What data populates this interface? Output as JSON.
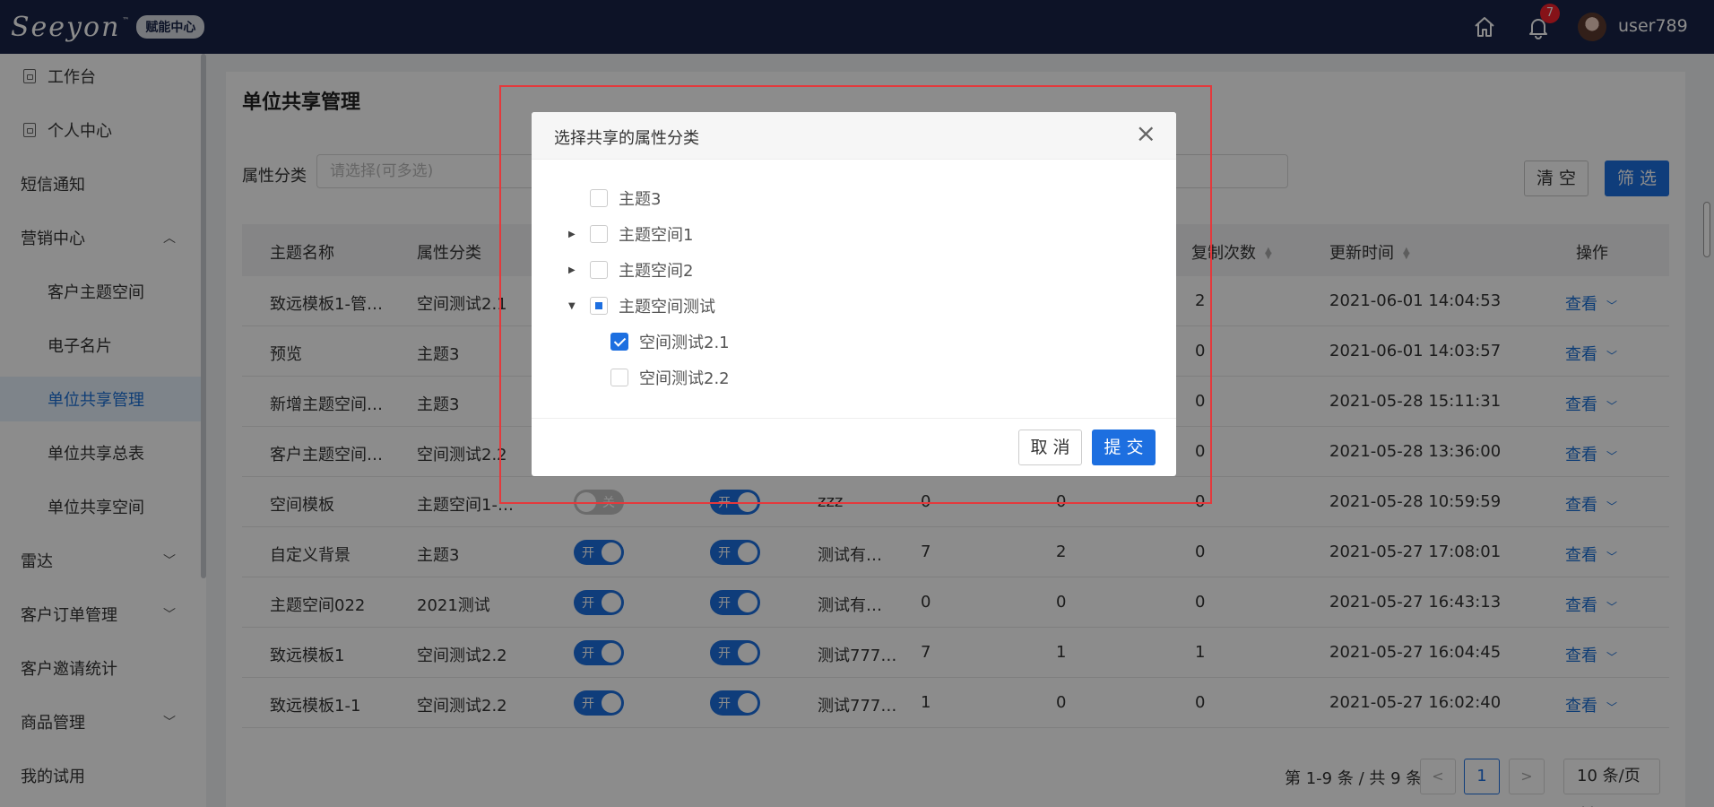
{
  "header": {
    "logo_text": "Seeyon",
    "logo_tm": "™",
    "logo_badge": "赋能中心",
    "notification_count": "7",
    "username": "user789"
  },
  "sidebar": {
    "items": [
      {
        "label": "工作台"
      },
      {
        "label": "个人中心"
      },
      {
        "label": "短信通知"
      },
      {
        "label": "营销中心"
      },
      {
        "label": "客户主题空间"
      },
      {
        "label": "电子名片"
      },
      {
        "label": "单位共享管理"
      },
      {
        "label": "单位共享总表"
      },
      {
        "label": "单位共享空间"
      },
      {
        "label": "雷达"
      },
      {
        "label": "客户订单管理"
      },
      {
        "label": "客户邀请统计"
      },
      {
        "label": "商品管理"
      },
      {
        "label": "我的试用"
      }
    ]
  },
  "page": {
    "title": "单位共享管理",
    "filter_label": "属性分类",
    "filter_placeholder": "请选择(可多选)",
    "clear_label": "清 空",
    "filter_label_btn": "筛 选"
  },
  "table": {
    "headers": [
      "主题名称",
      "属性分类",
      "复制次数",
      "更新时间",
      "操作"
    ],
    "toggle_on": "开",
    "toggle_off": "关",
    "action_label": "查看",
    "rows": [
      {
        "name": "致远模板1-管…",
        "category": "空间测试2.1",
        "copies": "2",
        "time": "2021-06-01 14:04:53"
      },
      {
        "name": "预览",
        "category": "主题3",
        "copies": "0",
        "time": "2021-06-01 14:03:57"
      },
      {
        "name": "新增主题空间…",
        "category": "主题3",
        "copies": "0",
        "time": "2021-05-28 15:11:31"
      },
      {
        "name": "客户主题空间…",
        "category": "空间测试2.2",
        "copies": "0",
        "time": "2021-05-28 13:36:00"
      },
      {
        "name": "空间模板",
        "category": "主题空间1-…",
        "t1": "关",
        "t2": "开",
        "desc": "zzz",
        "n1": "0",
        "n2": "0",
        "copies": "0",
        "time": "2021-05-28 10:59:59"
      },
      {
        "name": "自定义背景",
        "category": "主题3",
        "t1": "开",
        "t2": "开",
        "desc": "测试有…",
        "n1": "7",
        "n2": "2",
        "copies": "0",
        "time": "2021-05-27 17:08:01"
      },
      {
        "name": "主题空间022",
        "category": "2021测试",
        "t1": "开",
        "t2": "开",
        "desc": "测试有…",
        "n1": "0",
        "n2": "0",
        "copies": "0",
        "time": "2021-05-27 16:43:13"
      },
      {
        "name": "致远模板1",
        "category": "空间测试2.2",
        "t1": "开",
        "t2": "开",
        "desc": "测试777…",
        "n1": "7",
        "n2": "1",
        "copies": "1",
        "time": "2021-05-27 16:04:45"
      },
      {
        "name": "致远模板1-1",
        "category": "空间测试2.2",
        "t1": "开",
        "t2": "开",
        "desc": "测试777…",
        "n1": "1",
        "n2": "0",
        "copies": "0",
        "time": "2021-05-27 16:02:40"
      }
    ]
  },
  "pagination": {
    "info": "第 1-9 条 / 共 9 条",
    "prev": "<",
    "current": "1",
    "next": ">",
    "page_size": "10 条/页"
  },
  "dialog": {
    "title": "选择共享的属性分类",
    "close": "×",
    "tree": [
      {
        "label": "主题3"
      },
      {
        "label": "主题空间1"
      },
      {
        "label": "主题空间2"
      },
      {
        "label": "主题空间测试"
      },
      {
        "label": "空间测试2.1"
      },
      {
        "label": "空间测试2.2"
      }
    ],
    "cancel_label": "取 消",
    "submit_label": "提 交"
  },
  "colors": {
    "primary": "#1d6fe0",
    "topbar": "#182447",
    "highlight": "#e4393c"
  }
}
